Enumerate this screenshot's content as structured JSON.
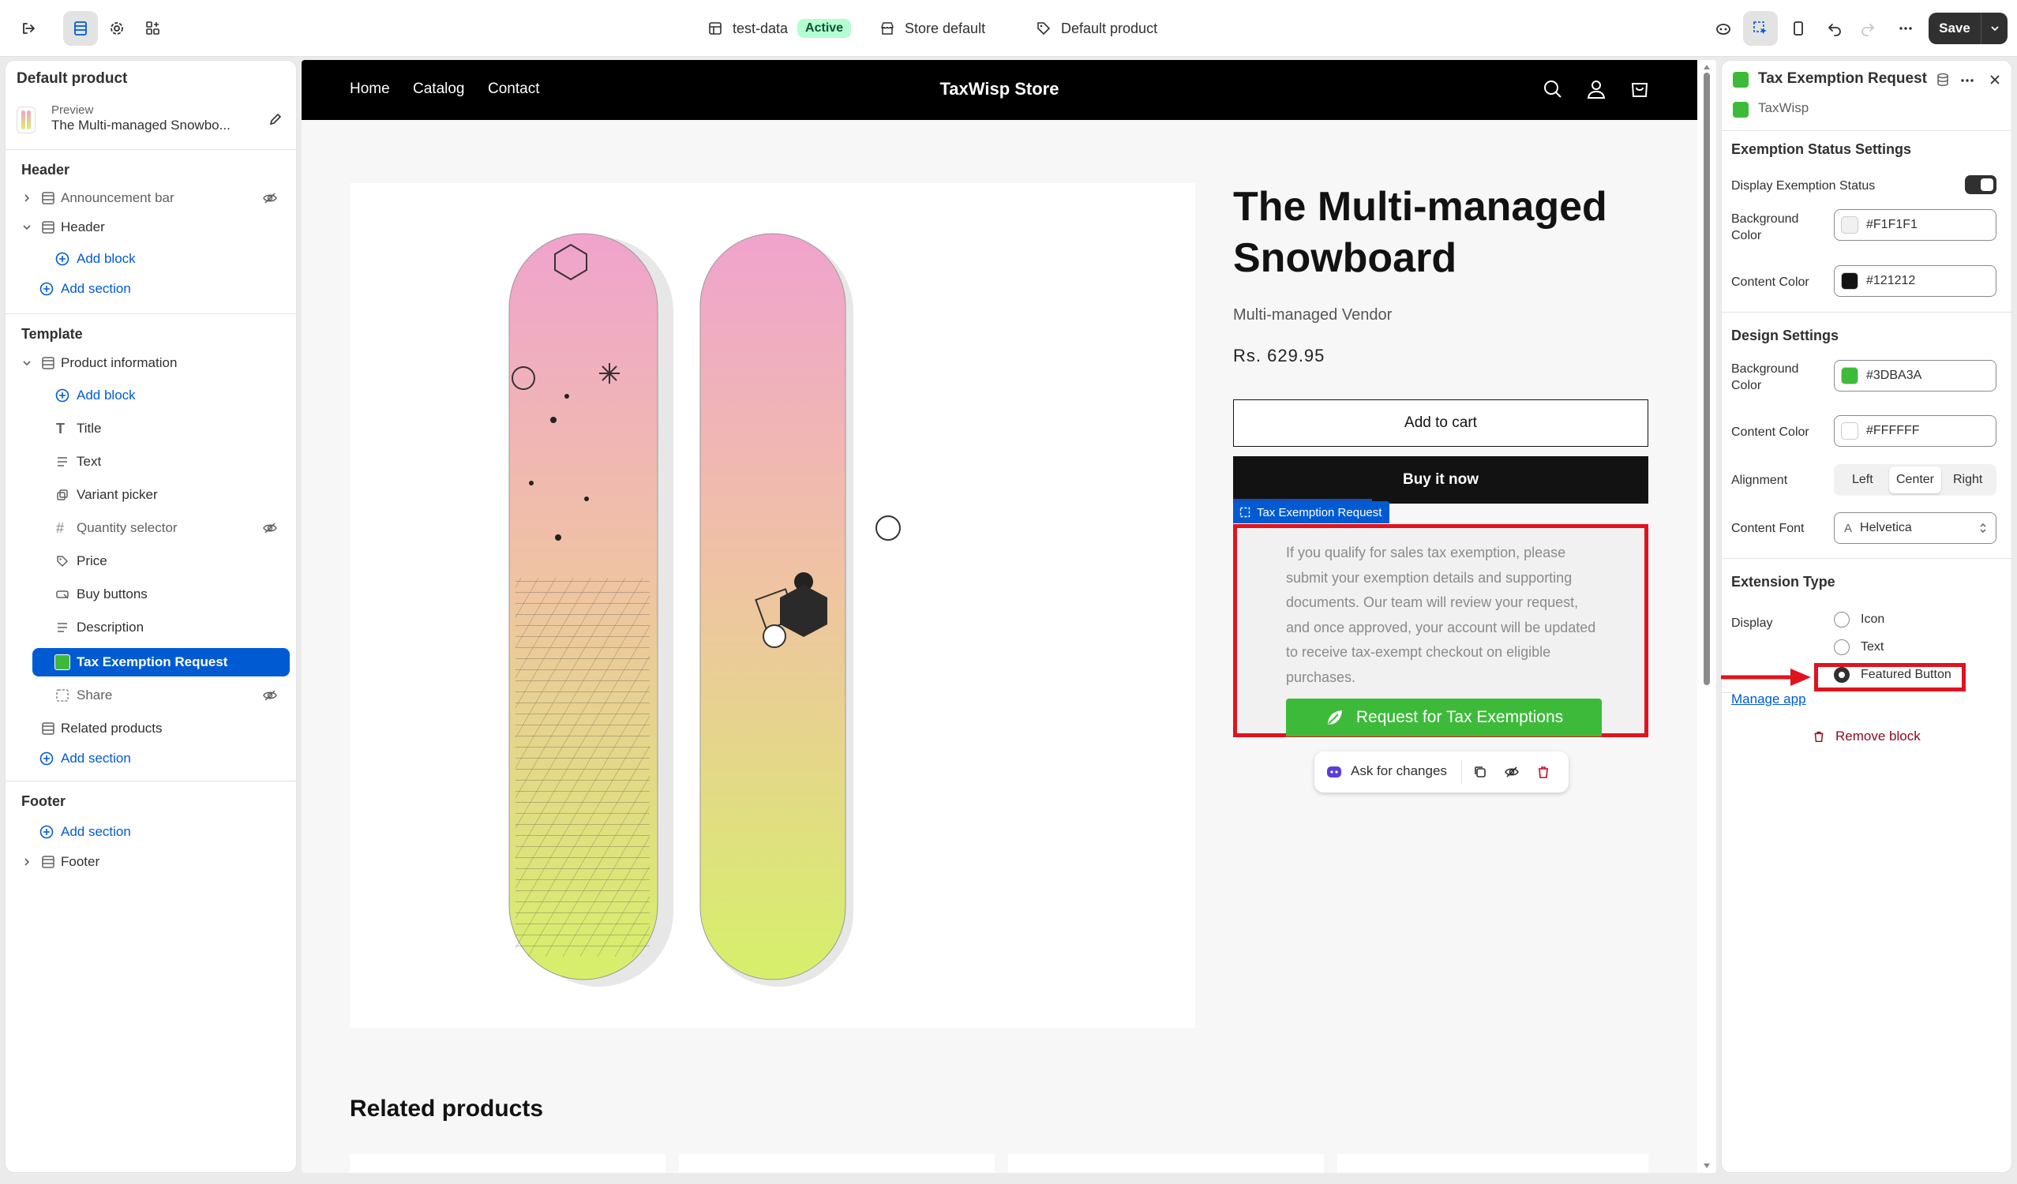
{
  "topbar": {
    "store_data": "test-data",
    "status_badge": "Active",
    "store": "Store default",
    "template": "Default product",
    "save_label": "Save"
  },
  "left_panel": {
    "title": "Default product",
    "preview_label": "Preview",
    "preview_value": "The Multi-managed Snowbo...",
    "header_group": "Header",
    "header_items": [
      "Announcement bar",
      "Header"
    ],
    "add_block": "Add block",
    "add_section": "Add section",
    "template_group": "Template",
    "product_information": "Product information",
    "blocks": [
      "Title",
      "Text",
      "Variant picker",
      "Quantity selector",
      "Price",
      "Buy buttons",
      "Description",
      "Tax Exemption Request",
      "Share"
    ],
    "related_products": "Related products",
    "footer_group": "Footer",
    "footer_item": "Footer"
  },
  "store": {
    "nav": [
      "Home",
      "Catalog",
      "Contact"
    ],
    "name": "TaxWisp Store"
  },
  "product": {
    "title": "The Multi-managed Snowboard",
    "vendor": "Multi-managed Vendor",
    "price": "Rs. 629.95",
    "add_to_cart": "Add to cart",
    "buy_now": "Buy it now",
    "selected_tag": "Tax Exemption Request",
    "tax_text": "If you qualify for sales tax exemption, please submit your exemption details and supporting documents. Our team will review your request, and once approved, your account will be updated to receive tax-exempt checkout on eligible purchases.",
    "tax_button": "Request for Tax Exemptions",
    "ask_changes": "Ask for changes",
    "related_heading": "Related products"
  },
  "right_panel": {
    "title": "Tax Exemption Request",
    "app_name": "TaxWisp",
    "exemption_heading": "Exemption Status Settings",
    "display_status_label": "Display Exemption Status",
    "display_status_on": true,
    "bg_color_label": "Background Color",
    "bg_color_value": "#F1F1F1",
    "content_color_label": "Content Color",
    "content_color_value": "#121212",
    "design_heading": "Design Settings",
    "design_bg_label": "Background Color",
    "design_bg_value": "#3DBA3A",
    "design_content_label": "Content Color",
    "design_content_value": "#FFFFFF",
    "alignment_label": "Alignment",
    "alignment_options": [
      "Left",
      "Center",
      "Right"
    ],
    "alignment_selected": "Center",
    "font_label": "Content Font",
    "font_value": "Helvetica",
    "extension_heading": "Extension Type",
    "display_label": "Display",
    "display_options": [
      "Icon",
      "Text",
      "Featured Button"
    ],
    "display_selected": "Featured Button",
    "manage_app": "Manage app",
    "remove_block": "Remove block"
  },
  "colors": {
    "accent_blue": "#005bd3",
    "highlight_red": "#e0131f",
    "button_green": "#3dba3a"
  }
}
